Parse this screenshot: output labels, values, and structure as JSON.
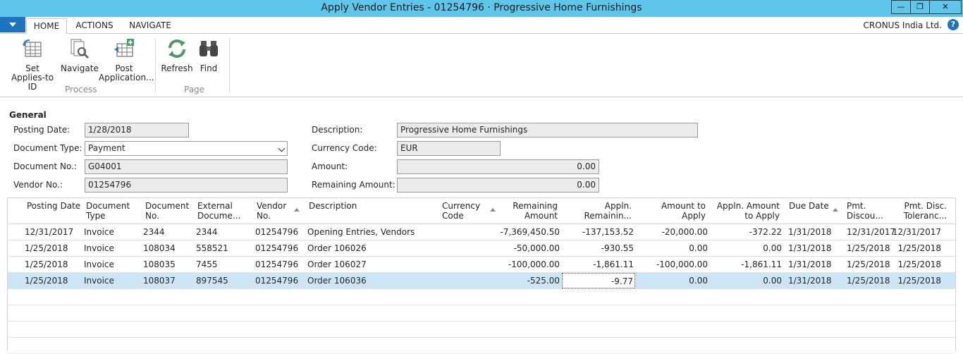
{
  "window": {
    "title": "Apply Vendor Entries - 01254796 · Progressive Home Furnishings",
    "minimize": "—",
    "restore": "❐",
    "close": "✕"
  },
  "tabs": [
    {
      "label": "HOME"
    },
    {
      "label": "ACTIONS"
    },
    {
      "label": "NAVIGATE"
    }
  ],
  "company": "CRONUS India Ltd.",
  "help": "?",
  "ribbon": {
    "buttons": [
      {
        "line1": "Set",
        "line2": "Applies-to ID",
        "icon": "set-applies-to-id-icon"
      },
      {
        "line1": "Navigate",
        "line2": "",
        "icon": "navigate-icon"
      },
      {
        "line1": "Post",
        "line2": "Application...",
        "icon": "post-application-icon"
      },
      {
        "line1": "Refresh",
        "line2": "",
        "icon": "refresh-icon"
      },
      {
        "line1": "Find",
        "line2": "",
        "icon": "find-icon"
      }
    ],
    "groups": [
      {
        "label": "Process"
      },
      {
        "label": "Page"
      }
    ]
  },
  "general": {
    "title": "General",
    "posting_date_label": "Posting Date:",
    "posting_date": "1/28/2018",
    "document_type_label": "Document Type:",
    "document_type": "Payment",
    "document_no_label": "Document No.:",
    "document_no": "G04001",
    "vendor_no_label": "Vendor No.:",
    "vendor_no": "01254796",
    "description_label": "Description:",
    "description": "Progressive Home Furnishings",
    "currency_code_label": "Currency Code:",
    "currency_code": "EUR",
    "amount_label": "Amount:",
    "amount": "0.00",
    "remaining_amount_label": "Remaining Amount:",
    "remaining_amount": "0.00"
  },
  "table": {
    "headers": {
      "posting_date": "Posting Date",
      "document_type_1": "Document",
      "document_type_2": "Type",
      "document_no_1": "Document",
      "document_no_2": "No.",
      "external_1": "External",
      "external_2": "Docume...",
      "vendor_no_1": "Vendor",
      "vendor_no_2": "No.",
      "description": "Description",
      "currency_1": "Currency",
      "currency_2": "Code",
      "remaining_1": "Remaining",
      "remaining_2": "Amount",
      "appln_rem_1": "Appln.",
      "appln_rem_2": "Remainin...",
      "amount_to_apply": "Amount to Apply",
      "appln_amt_1": "Appln. Amount",
      "appln_amt_2": "to Apply",
      "due_date": "Due Date",
      "pmt_disc_1": "Pmt.",
      "pmt_disc_2": "Discou...",
      "pmt_tol_1": "Pmt. Disc.",
      "pmt_tol_2": "Toleranc..."
    },
    "rows": [
      {
        "posting_date": "12/31/2017",
        "document_type": "Invoice",
        "document_no": "2344",
        "external_doc": "2344",
        "vendor_no": "01254796",
        "description": "Opening Entries, Vendors",
        "currency": "",
        "remaining": "-7,369,450.50",
        "appln_remaining": "-137,153.52",
        "amount_to_apply": "-20,000.00",
        "appln_amount_to_apply": "-372.22",
        "due_date": "1/31/2018",
        "pmt_discount_date": "12/31/2017",
        "pmt_disc_tolerance": "12/31/2017"
      },
      {
        "posting_date": "1/25/2018",
        "document_type": "Invoice",
        "document_no": "108034",
        "external_doc": "558521",
        "vendor_no": "01254796",
        "description": "Order 106026",
        "currency": "",
        "remaining": "-50,000.00",
        "appln_remaining": "-930.55",
        "amount_to_apply": "0.00",
        "appln_amount_to_apply": "0.00",
        "due_date": "1/31/2018",
        "pmt_discount_date": "1/25/2018",
        "pmt_disc_tolerance": "1/25/2018"
      },
      {
        "posting_date": "1/25/2018",
        "document_type": "Invoice",
        "document_no": "108035",
        "external_doc": "7455",
        "vendor_no": "01254796",
        "description": "Order 106027",
        "currency": "",
        "remaining": "-100,000.00",
        "appln_remaining": "-1,861.11",
        "amount_to_apply": "-100,000.00",
        "appln_amount_to_apply": "-1,861.11",
        "due_date": "1/31/2018",
        "pmt_discount_date": "1/25/2018",
        "pmt_disc_tolerance": "1/25/2018"
      },
      {
        "posting_date": "1/25/2018",
        "document_type": "Invoice",
        "document_no": "108037",
        "external_doc": "897545",
        "vendor_no": "01254796",
        "description": "Order 106036",
        "currency": "",
        "remaining": "-525.00",
        "appln_remaining": "-9.77",
        "amount_to_apply": "0.00",
        "appln_amount_to_apply": "0.00",
        "due_date": "1/31/2018",
        "pmt_discount_date": "1/25/2018",
        "pmt_disc_tolerance": "1/25/2018"
      }
    ],
    "selected_row": 3
  }
}
